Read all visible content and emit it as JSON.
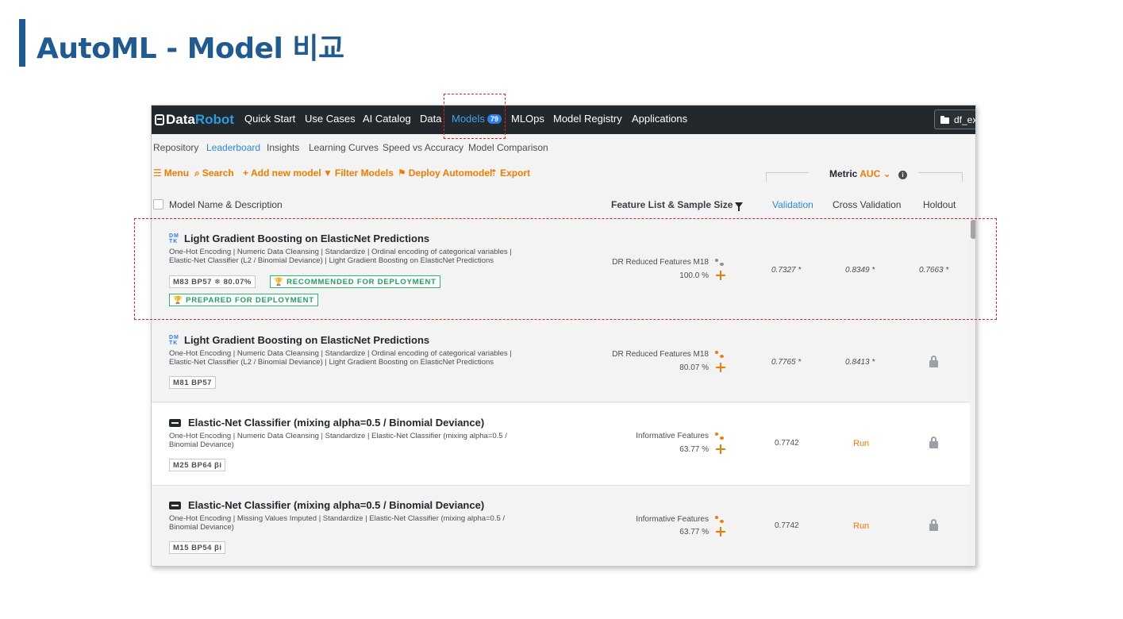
{
  "slide": {
    "title": "AutoML - Model 비교"
  },
  "app": {
    "logo": {
      "data": "Data",
      "robot": "Robot"
    },
    "nav": {
      "quick_start": "Quick Start",
      "use_cases": "Use Cases",
      "ai_catalog": "AI Catalog",
      "data": "Data",
      "models": "Models",
      "models_count": "79",
      "mlops": "MLOps",
      "model_registry": "Model Registry",
      "applications": "Applications",
      "project": "df_exp"
    },
    "subnav": {
      "repository": "Repository",
      "leaderboard": "Leaderboard",
      "insights": "Insights",
      "learning_curves": "Learning Curves",
      "speed_vs_accuracy": "Speed vs Accuracy",
      "model_comparison": "Model Comparison"
    },
    "actions": {
      "menu": "Menu",
      "search": "Search",
      "add_new_model": "Add new model",
      "filter_models": "Filter Models",
      "deploy_automodel": "Deploy Automodel",
      "export": "Export"
    },
    "metric": {
      "label": "Metric",
      "value": "AUC"
    },
    "columns": {
      "model_name": "Model Name & Description",
      "feature_list": "Feature List & Sample Size",
      "validation": "Validation",
      "cross_validation": "Cross Validation",
      "holdout": "Holdout"
    },
    "rows": [
      {
        "icon": "dmtk-icon",
        "title": "Light Gradient Boosting on ElasticNet Predictions",
        "desc": "One-Hot Encoding | Numeric Data Cleansing | Standardize | Ordinal encoding of categorical variables | Elastic-Net Classifier (L2 / Binomial Deviance) | Light Gradient Boosting on ElasticNet Predictions",
        "tag": "M83  BP57  ❄ 80.07%",
        "badges": [
          "RECOMMENDED FOR DEPLOYMENT",
          "PREPARED FOR DEPLOYMENT"
        ],
        "feature_list": "DR Reduced Features M18",
        "sample_size": "100.0 %",
        "validation": "0.7327 *",
        "cross_validation": "0.8349 *",
        "holdout": "0.7663 *"
      },
      {
        "icon": "dmtk-icon",
        "title": "Light Gradient Boosting on ElasticNet Predictions",
        "desc": "One-Hot Encoding | Numeric Data Cleansing | Standardize | Ordinal encoding of categorical variables | Elastic-Net Classifier (L2 / Binomial Deviance) | Light Gradient Boosting on ElasticNet Predictions",
        "tag": "M81  BP57",
        "feature_list": "DR Reduced Features M18",
        "sample_size": "80.07 %",
        "validation": "0.7765 *",
        "cross_validation": "0.8413 *",
        "holdout": "locked"
      },
      {
        "icon": "elastic-net-icon",
        "title": "Elastic-Net Classifier (mixing alpha=0.5 / Binomial Deviance)",
        "desc": "One-Hot Encoding | Numeric Data Cleansing | Standardize | Elastic-Net Classifier (mixing alpha=0.5 / Binomial Deviance)",
        "tag": "M25  BP64  βi",
        "feature_list": "Informative Features",
        "sample_size": "63.77 %",
        "validation": "0.7742",
        "cross_validation": "Run",
        "holdout": "locked"
      },
      {
        "icon": "elastic-net-icon",
        "title": "Elastic-Net Classifier (mixing alpha=0.5 / Binomial Deviance)",
        "desc": "One-Hot Encoding | Missing Values Imputed | Standardize | Elastic-Net Classifier (mixing alpha=0.5 / Binomial Deviance)",
        "tag": "M15  BP54  βi",
        "feature_list": "Informative Features",
        "sample_size": "63.77 %",
        "validation": "0.7742",
        "cross_validation": "Run",
        "holdout": "locked"
      }
    ]
  },
  "colors": {
    "title": "#1f5a93",
    "accent_orange": "#f07c00",
    "accent_blue": "#2d8ad8",
    "topbar": "#23282d",
    "green": "#1f9e5e",
    "highlight": "#e02424"
  }
}
